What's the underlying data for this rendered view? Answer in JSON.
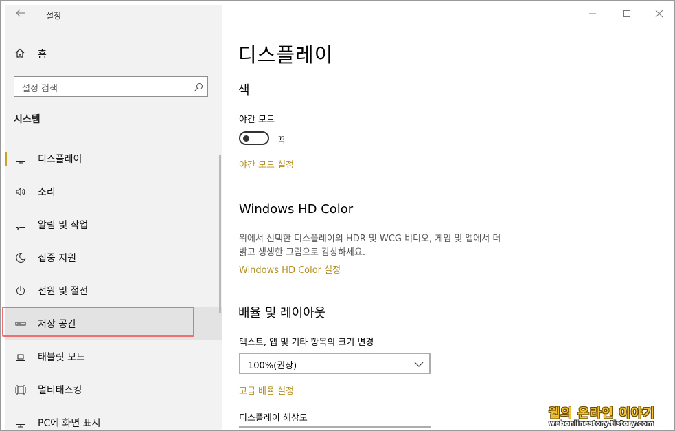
{
  "window": {
    "title": "설정",
    "back_icon": "back-arrow-icon"
  },
  "sidebar": {
    "home_label": "홈",
    "search_placeholder": "설정 검색",
    "section_title": "시스템",
    "items": [
      {
        "label": "디스플레이",
        "icon": "monitor-icon"
      },
      {
        "label": "소리",
        "icon": "speaker-icon"
      },
      {
        "label": "알림 및 작업",
        "icon": "notification-icon"
      },
      {
        "label": "집중 지원",
        "icon": "moon-icon"
      },
      {
        "label": "전원 및 절전",
        "icon": "power-icon"
      },
      {
        "label": "저장 공간",
        "icon": "storage-icon"
      },
      {
        "label": "태블릿 모드",
        "icon": "tablet-icon"
      },
      {
        "label": "멀티태스킹",
        "icon": "multitask-icon"
      },
      {
        "label": "PC에 화면 표시",
        "icon": "project-icon"
      }
    ]
  },
  "main": {
    "title": "디스플레이",
    "color_heading": "색",
    "night_mode_label": "야간 모드",
    "night_mode_state": "끔",
    "night_mode_link": "야간 모드 설정",
    "hd_heading": "Windows HD Color",
    "hd_desc_line1": "위에서 선택한 디스플레이의 HDR 및 WCG 비디오, 게임 및 앱에서 더",
    "hd_desc_line2": "밝고 생생한 그림으로 감상하세요.",
    "hd_link": "Windows HD Color 설정",
    "scale_heading": "배율 및 레이아웃",
    "scale_label": "텍스트, 앱 및 기타 항목의 크기 변경",
    "scale_value": "100%(권장)",
    "advanced_scale_link": "고급 배율 설정",
    "resolution_label": "디스플레이 해상도"
  },
  "watermark": {
    "title": "웹의 온라인 이야기",
    "url": "webonlinestory.tistory.com"
  },
  "colors": {
    "accent": "#b39024",
    "highlight_border": "#ef6f72",
    "sidebar_bg": "#f2f2f2"
  }
}
